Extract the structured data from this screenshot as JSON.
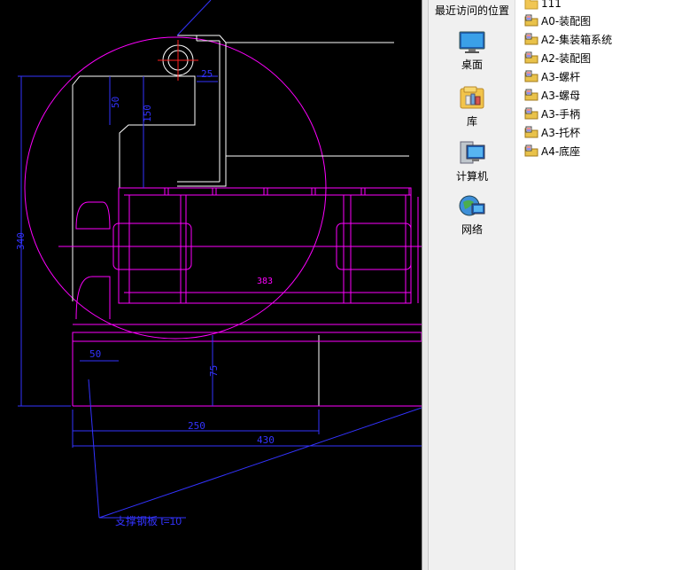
{
  "cad": {
    "dimensions": {
      "d340": "340",
      "d50_left": "50",
      "d150": "150",
      "d25": "25",
      "d383": "383",
      "d50_bottom": "50",
      "d75": "75",
      "d250": "250",
      "d430": "430"
    },
    "annotation": "支撑钢板 t=10"
  },
  "places": {
    "recent": "最近访问的位置",
    "items": [
      {
        "label": "桌面",
        "icon": "desktop-icon"
      },
      {
        "label": "库",
        "icon": "library-icon"
      },
      {
        "label": "计算机",
        "icon": "computer-icon"
      },
      {
        "label": "网络",
        "icon": "network-icon"
      }
    ]
  },
  "files": [
    {
      "name": "111",
      "icon": "folder-icon"
    },
    {
      "name": "A0-装配图",
      "icon": "cad-file-icon"
    },
    {
      "name": "A2-集装箱系统",
      "icon": "cad-file-icon"
    },
    {
      "name": "A2-装配图",
      "icon": "cad-file-icon"
    },
    {
      "name": "A3-螺杆",
      "icon": "cad-file-icon"
    },
    {
      "name": "A3-螺母",
      "icon": "cad-file-icon"
    },
    {
      "name": "A3-手柄",
      "icon": "cad-file-icon"
    },
    {
      "name": "A3-托杯",
      "icon": "cad-file-icon"
    },
    {
      "name": "A4-底座",
      "icon": "cad-file-icon"
    }
  ],
  "colors": {
    "cad_bg": "#000000",
    "magenta": "#ff00ff",
    "blue": "#3333ff",
    "white": "#ffffff",
    "red": "#ff2020"
  }
}
